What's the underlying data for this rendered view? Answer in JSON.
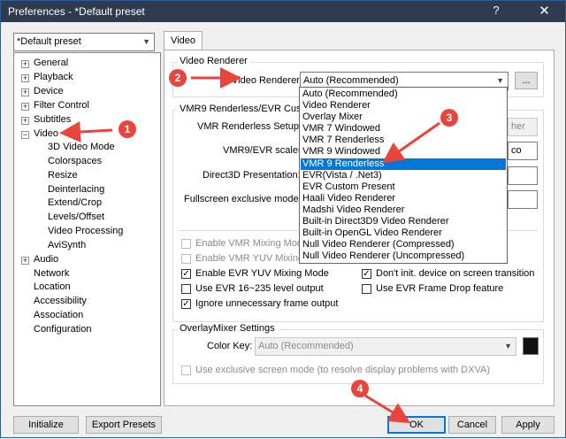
{
  "window": {
    "title": "Preferences - *Default preset",
    "help_glyph": "?",
    "close_glyph": "✕"
  },
  "preset": {
    "value": "*Default preset"
  },
  "tree": {
    "items": [
      {
        "label": "General",
        "expander": "+"
      },
      {
        "label": "Playback",
        "expander": "+"
      },
      {
        "label": "Device",
        "expander": "+"
      },
      {
        "label": "Filter Control",
        "expander": "+"
      },
      {
        "label": "Subtitles",
        "expander": "+"
      },
      {
        "label": "Video",
        "expander": "−"
      },
      {
        "label": "3D Video Mode"
      },
      {
        "label": "Colorspaces"
      },
      {
        "label": "Resize"
      },
      {
        "label": "Deinterlacing"
      },
      {
        "label": "Extend/Crop"
      },
      {
        "label": "Levels/Offset"
      },
      {
        "label": "Video Processing"
      },
      {
        "label": "AviSynth"
      },
      {
        "label": "Audio",
        "expander": "+"
      },
      {
        "label": "Network"
      },
      {
        "label": "Location"
      },
      {
        "label": "Accessibility"
      },
      {
        "label": "Association"
      },
      {
        "label": "Configuration"
      }
    ]
  },
  "tab": {
    "label": "Video"
  },
  "renderer": {
    "group_title": "Video Renderer",
    "label": "Video Renderer:",
    "value": "Auto (Recommended)",
    "more_button": "...",
    "options": [
      "Auto (Recommended)",
      "Video Renderer",
      "Overlay Mixer",
      "VMR 7 Windowed",
      "VMR 7 Renderless",
      "VMR 9 Windowed",
      "VMR 9 Renderless",
      "EVR(Vista / .Net3)",
      "EVR Custom Present",
      "Haali Video Renderer",
      "Madshi Video Renderer",
      "Built-in Direct3D9 Video Renderer",
      "Built-in OpenGL Video Renderer",
      "Null Video Renderer (Compressed)",
      "Null Video Renderer (Uncompressed)"
    ],
    "highlighted": "VMR 9 Renderless"
  },
  "vmr": {
    "group_title": "VMR9 Renderless/EVR Custom",
    "setup_label": "VMR Renderless Setup:",
    "setup_value_partial": "her",
    "scaler_label": "VMR9/EVR scaler:",
    "scaler_value_partial": "co",
    "d3d_label": "Direct3D Presentation:",
    "fullscreen_label": "Fullscreen exclusive mode:",
    "checkboxes": [
      {
        "label": "Enable VMR Mixing Mode",
        "checked": false,
        "enabled": false
      },
      {
        "label": "Enable VMR YUV Mixing M",
        "checked": false,
        "enabled": false
      },
      {
        "label": "Enable EVR YUV Mixing Mode",
        "checked": true,
        "enabled": true
      },
      {
        "label": "Don't init. device on screen transition",
        "checked": true,
        "enabled": true
      },
      {
        "label": "Use EVR 16~235 level output",
        "checked": false,
        "enabled": true
      },
      {
        "label": "Use EVR Frame Drop feature",
        "checked": false,
        "enabled": true
      },
      {
        "label": "Ignore unnecessary frame output",
        "checked": true,
        "enabled": true
      }
    ]
  },
  "overlay": {
    "group_title": "OverlayMixer Settings",
    "color_key_label": "Color Key:",
    "color_key_value": "Auto (Recommended)",
    "exclusive_label": "Use exclusive screen mode (to resolve display problems with DXVA)"
  },
  "footer": {
    "initialize": "Initialize",
    "export": "Export Presets",
    "ok": "OK",
    "cancel": "Cancel",
    "apply": "Apply"
  },
  "annotations": {
    "badges": [
      "1",
      "2",
      "3",
      "4"
    ],
    "color": "#e8453c"
  },
  "colors": {
    "selection": "#0078d7",
    "titlebar": "#2f3b4e",
    "color_key_swatch": "#111111"
  }
}
